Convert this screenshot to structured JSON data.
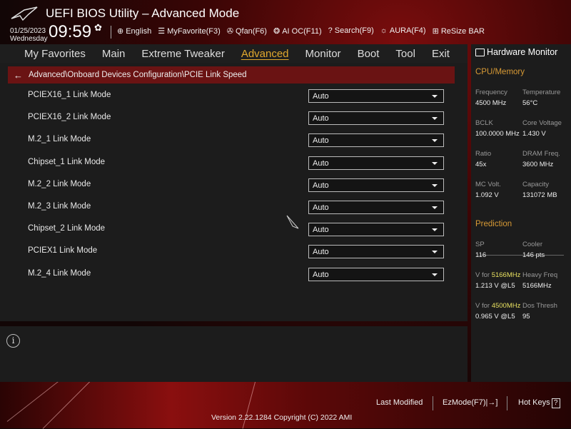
{
  "header": {
    "title": "UEFI BIOS Utility – Advanced Mode",
    "date": "01/25/2023",
    "day": "Wednesday",
    "time": "09:59",
    "tools": [
      {
        "icon": "globe-icon",
        "glyph": "⊕",
        "label": "English"
      },
      {
        "icon": "myfavorite-icon",
        "glyph": "☰",
        "label": "MyFavorite(F3)"
      },
      {
        "icon": "fan-icon",
        "glyph": "✇",
        "label": "Qfan(F6)"
      },
      {
        "icon": "ai-oc-icon",
        "glyph": "❂",
        "label": "AI OC(F11)"
      },
      {
        "icon": "search-icon",
        "glyph": "?",
        "label": "Search(F9)"
      },
      {
        "icon": "aura-icon",
        "glyph": "☼",
        "label": "AURA(F4)"
      },
      {
        "icon": "resize-bar-icon",
        "glyph": "⊞",
        "label": "ReSize BAR"
      }
    ]
  },
  "nav": [
    {
      "label": "My Favorites"
    },
    {
      "label": "Main"
    },
    {
      "label": "Extreme Tweaker"
    },
    {
      "label": "Advanced",
      "active": true
    },
    {
      "label": "Monitor"
    },
    {
      "label": "Boot"
    },
    {
      "label": "Tool"
    },
    {
      "label": "Exit"
    }
  ],
  "breadcrumb": "Advanced\\Onboard Devices Configuration\\PCIE Link Speed",
  "settings": [
    {
      "label": "PCIEX16_1 Link Mode",
      "value": "Auto"
    },
    {
      "label": "PCIEX16_2 Link Mode",
      "value": "Auto"
    },
    {
      "label": "M.2_1 Link Mode",
      "value": "Auto"
    },
    {
      "label": "Chipset_1 Link Mode",
      "value": "Auto"
    },
    {
      "label": "M.2_2 Link Mode",
      "value": "Auto"
    },
    {
      "label": "M.2_3 Link Mode",
      "value": "Auto"
    },
    {
      "label": "Chipset_2 Link Mode",
      "value": "Auto"
    },
    {
      "label": "PCIEX1 Link Mode",
      "value": "Auto"
    },
    {
      "label": "M.2_4 Link Mode",
      "value": "Auto"
    }
  ],
  "hw": {
    "title": "Hardware Monitor",
    "cpu_title": "CPU/Memory",
    "cpu": [
      {
        "k": "Frequency",
        "v": "4500 MHz"
      },
      {
        "k": "Temperature",
        "v": "56°C"
      },
      {
        "k": "BCLK",
        "v": "100.0000 MHz"
      },
      {
        "k": "Core Voltage",
        "v": "1.430 V"
      },
      {
        "k": "Ratio",
        "v": "45x"
      },
      {
        "k": "DRAM Freq.",
        "v": "3600 MHz"
      },
      {
        "k": "MC Volt.",
        "v": "1.092 V"
      },
      {
        "k": "Capacity",
        "v": "131072 MB"
      }
    ],
    "pred_title": "Prediction",
    "pred": {
      "sp_k": "SP",
      "sp_v": "116",
      "cooler_k": "Cooler",
      "cooler_v": "146 pts",
      "vfor": "V for ",
      "f1": "5166MHz",
      "v1": "1.213 V @L5",
      "heavy_k": "Heavy Freq",
      "heavy_v": "5166MHz",
      "f2": "4500MHz",
      "v2": "0.965 V @L5",
      "dos_k": "Dos Thresh",
      "dos_v": "95"
    }
  },
  "footer": {
    "last_modified": "Last Modified",
    "ezmode": "EzMode(F7)|→]",
    "hotkeys": "Hot Keys",
    "hotkeys_icon": "?",
    "version": "Version 2.22.1284 Copyright (C) 2022 AMI"
  },
  "colors": {
    "accent": "#e0a82e",
    "crumb": "#6a1313",
    "highlight": "#e8e060"
  }
}
